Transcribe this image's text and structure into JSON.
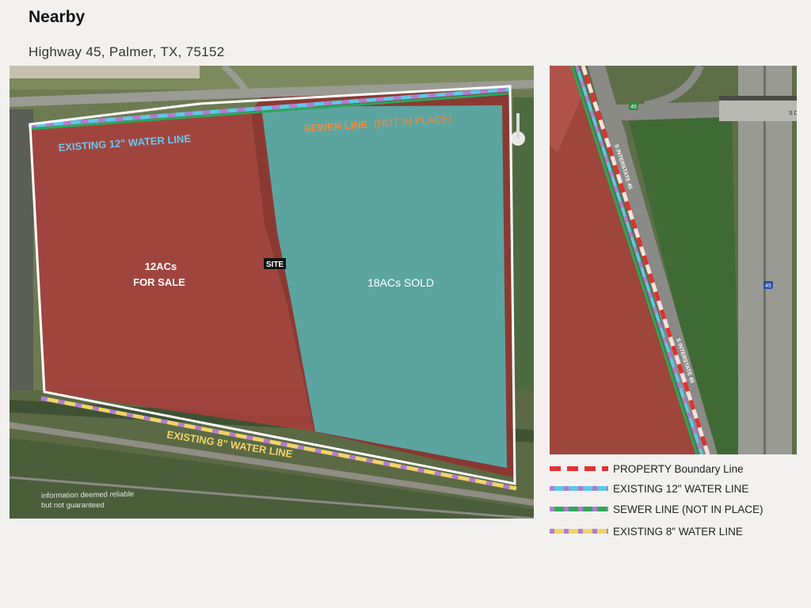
{
  "header": {
    "title": "Nearby",
    "address": "Highway 45, Palmer, TX, 75152"
  },
  "map_main": {
    "parcel_for_sale_acres": "12ACs",
    "parcel_for_sale_status": "FOR SALE",
    "parcel_sold": "18ACs SOLD",
    "site_label": "SITE",
    "water_12_label": "EXISTING 12\" WATER LINE",
    "sewer_label_main": "SEWER LINE",
    "sewer_label_note": "(NOT IN PLACE)",
    "water_8_label": "EXISTING 8\" WATER LINE",
    "disclaimer_line1": "information deemed reliable",
    "disclaimer_line2": "but not guaranteed"
  },
  "map_side": {
    "road_label_1": "S INTERSTATE 45",
    "road_label_2": "S INTERSTATE 45",
    "bridge_label": "S D",
    "shield_top": "45",
    "shield_right": "45"
  },
  "legend": [
    {
      "label": "PROPERTY Boundary Line",
      "color": "#e33030",
      "dash_color": "#ffffff"
    },
    {
      "label": "EXISTING 12\" WATER LINE",
      "color": "#5ec8e8",
      "dash_color": "#b07cd0"
    },
    {
      "label": "SEWER LINE (NOT IN PLACE)",
      "color": "#2ca85a",
      "dash_color": "#b07cd0"
    },
    {
      "label": "EXISTING 8\" WATER LINE",
      "color": "#f1d36b",
      "dash_color": "#b07cd0"
    }
  ],
  "colors": {
    "for_sale_fill": "#a4413c",
    "sold_fill": "#5aaaa6",
    "boundary": "#ffffff",
    "water_12": "#5ec8e8",
    "sewer": "#2ca85a",
    "water_8": "#f1d36b",
    "sewer_text": "#f08a3c",
    "water_12_text": "#6cc6ee",
    "water_8_text": "#f1d36b"
  }
}
